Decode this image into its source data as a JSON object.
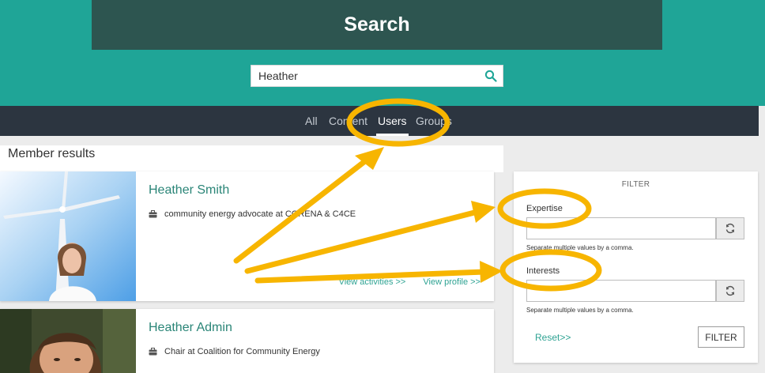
{
  "header": {
    "title": "Search",
    "search_value": "Heather",
    "search_icon": "search-icon"
  },
  "nav": {
    "tabs": [
      {
        "label": "All",
        "active": false
      },
      {
        "label": "Content",
        "active": false
      },
      {
        "label": "Users",
        "active": true
      },
      {
        "label": "Groups",
        "active": false
      }
    ]
  },
  "results": {
    "heading": "Member results",
    "members": [
      {
        "name": "Heather Smith",
        "role": "community energy advocate at CORENA & C4CE",
        "links": [
          "View activities >>",
          "View profile >>"
        ]
      },
      {
        "name": "Heather Admin",
        "role": "Chair at Coalition for Community Energy",
        "links": []
      }
    ]
  },
  "filter": {
    "title": "FILTER",
    "fields": [
      {
        "label": "Expertise",
        "value": "",
        "help": "Separate multiple values by a comma."
      },
      {
        "label": "Interests",
        "value": "",
        "help": "Separate multiple values by a comma."
      }
    ],
    "reset_label": "Reset>>",
    "submit_label": "FILTER"
  },
  "annotations": {
    "highlight_color": "#f7b500"
  },
  "colors": {
    "hero": "#1fa597",
    "title_band": "#2d5550",
    "nav": "#2c3540",
    "link": "#2fa393",
    "name": "#2a8577"
  }
}
